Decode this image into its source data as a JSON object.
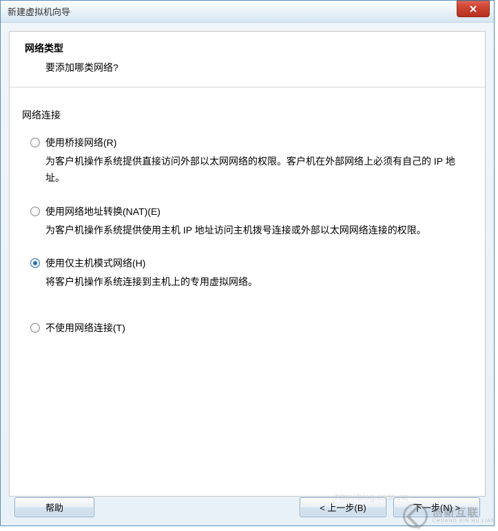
{
  "window": {
    "title": "新建虚拟机向导"
  },
  "header": {
    "title": "网络类型",
    "subtitle": "要添加哪类网络?"
  },
  "group": {
    "label": "网络连接"
  },
  "options": [
    {
      "label": "使用桥接网络(R)",
      "description": "为客户机操作系统提供直接访问外部以太网网络的权限。客户机在外部网络上必须有自己的 IP 地址。",
      "selected": false
    },
    {
      "label": "使用网络地址转换(NAT)(E)",
      "description": "为客户机操作系统提供使用主机 IP 地址访问主机拨号连接或外部以太网网络连接的权限。",
      "selected": false
    },
    {
      "label": "使用仅主机模式网络(H)",
      "description": "将客户机操作系统连接到主机上的专用虚拟网络。",
      "selected": true
    },
    {
      "label": "不使用网络连接(T)",
      "description": "",
      "selected": false
    }
  ],
  "buttons": {
    "help": "帮助",
    "prev": "< 上一步(B)",
    "next": "下一步(N) >"
  },
  "watermark": {
    "cn": "创新互联",
    "en": "CHUANG XIN HU LIAN",
    "url": "http://blog.csdn.ne"
  }
}
